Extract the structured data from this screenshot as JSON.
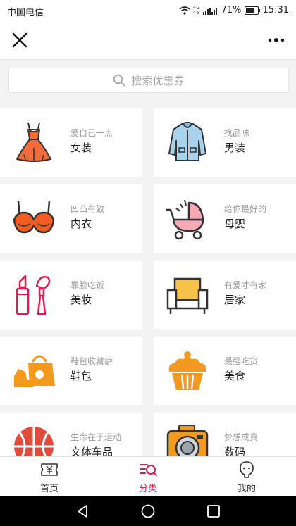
{
  "status_bar": {
    "carrier": "中国电信",
    "signal_small": "4G",
    "signal_small2": "46",
    "battery": "71%",
    "time": "15:31"
  },
  "search": {
    "placeholder": "搜索优惠券"
  },
  "categories": [
    {
      "sub": "爱自己一点",
      "title": "女装",
      "icon": "dress-icon"
    },
    {
      "sub": "找品味",
      "title": "男装",
      "icon": "jacket-icon"
    },
    {
      "sub": "凹凸有致",
      "title": "内衣",
      "icon": "bra-icon"
    },
    {
      "sub": "给你最好的",
      "title": "母婴",
      "icon": "stroller-icon"
    },
    {
      "sub": "靠脸吃饭",
      "title": "美妆",
      "icon": "makeup-icon"
    },
    {
      "sub": "有爱才有家",
      "title": "居家",
      "icon": "armchair-icon"
    },
    {
      "sub": "鞋包收藏癖",
      "title": "鞋包",
      "icon": "shoe-bag-icon"
    },
    {
      "sub": "最强吃货",
      "title": "美食",
      "icon": "cupcake-icon"
    },
    {
      "sub": "生命在于运动",
      "title": "文体车品",
      "icon": "basketball-icon"
    },
    {
      "sub": "梦想成真",
      "title": "数码",
      "icon": "camera-icon"
    }
  ],
  "tabs": [
    {
      "label": "首页",
      "icon": "ticket-icon"
    },
    {
      "label": "分类",
      "icon": "category-search-icon",
      "active": true
    },
    {
      "label": "我的",
      "icon": "profile-icon"
    }
  ],
  "colors": {
    "accent": "#e5194e",
    "orange": "#f39a1e",
    "red_orange": "#f26b3a"
  }
}
